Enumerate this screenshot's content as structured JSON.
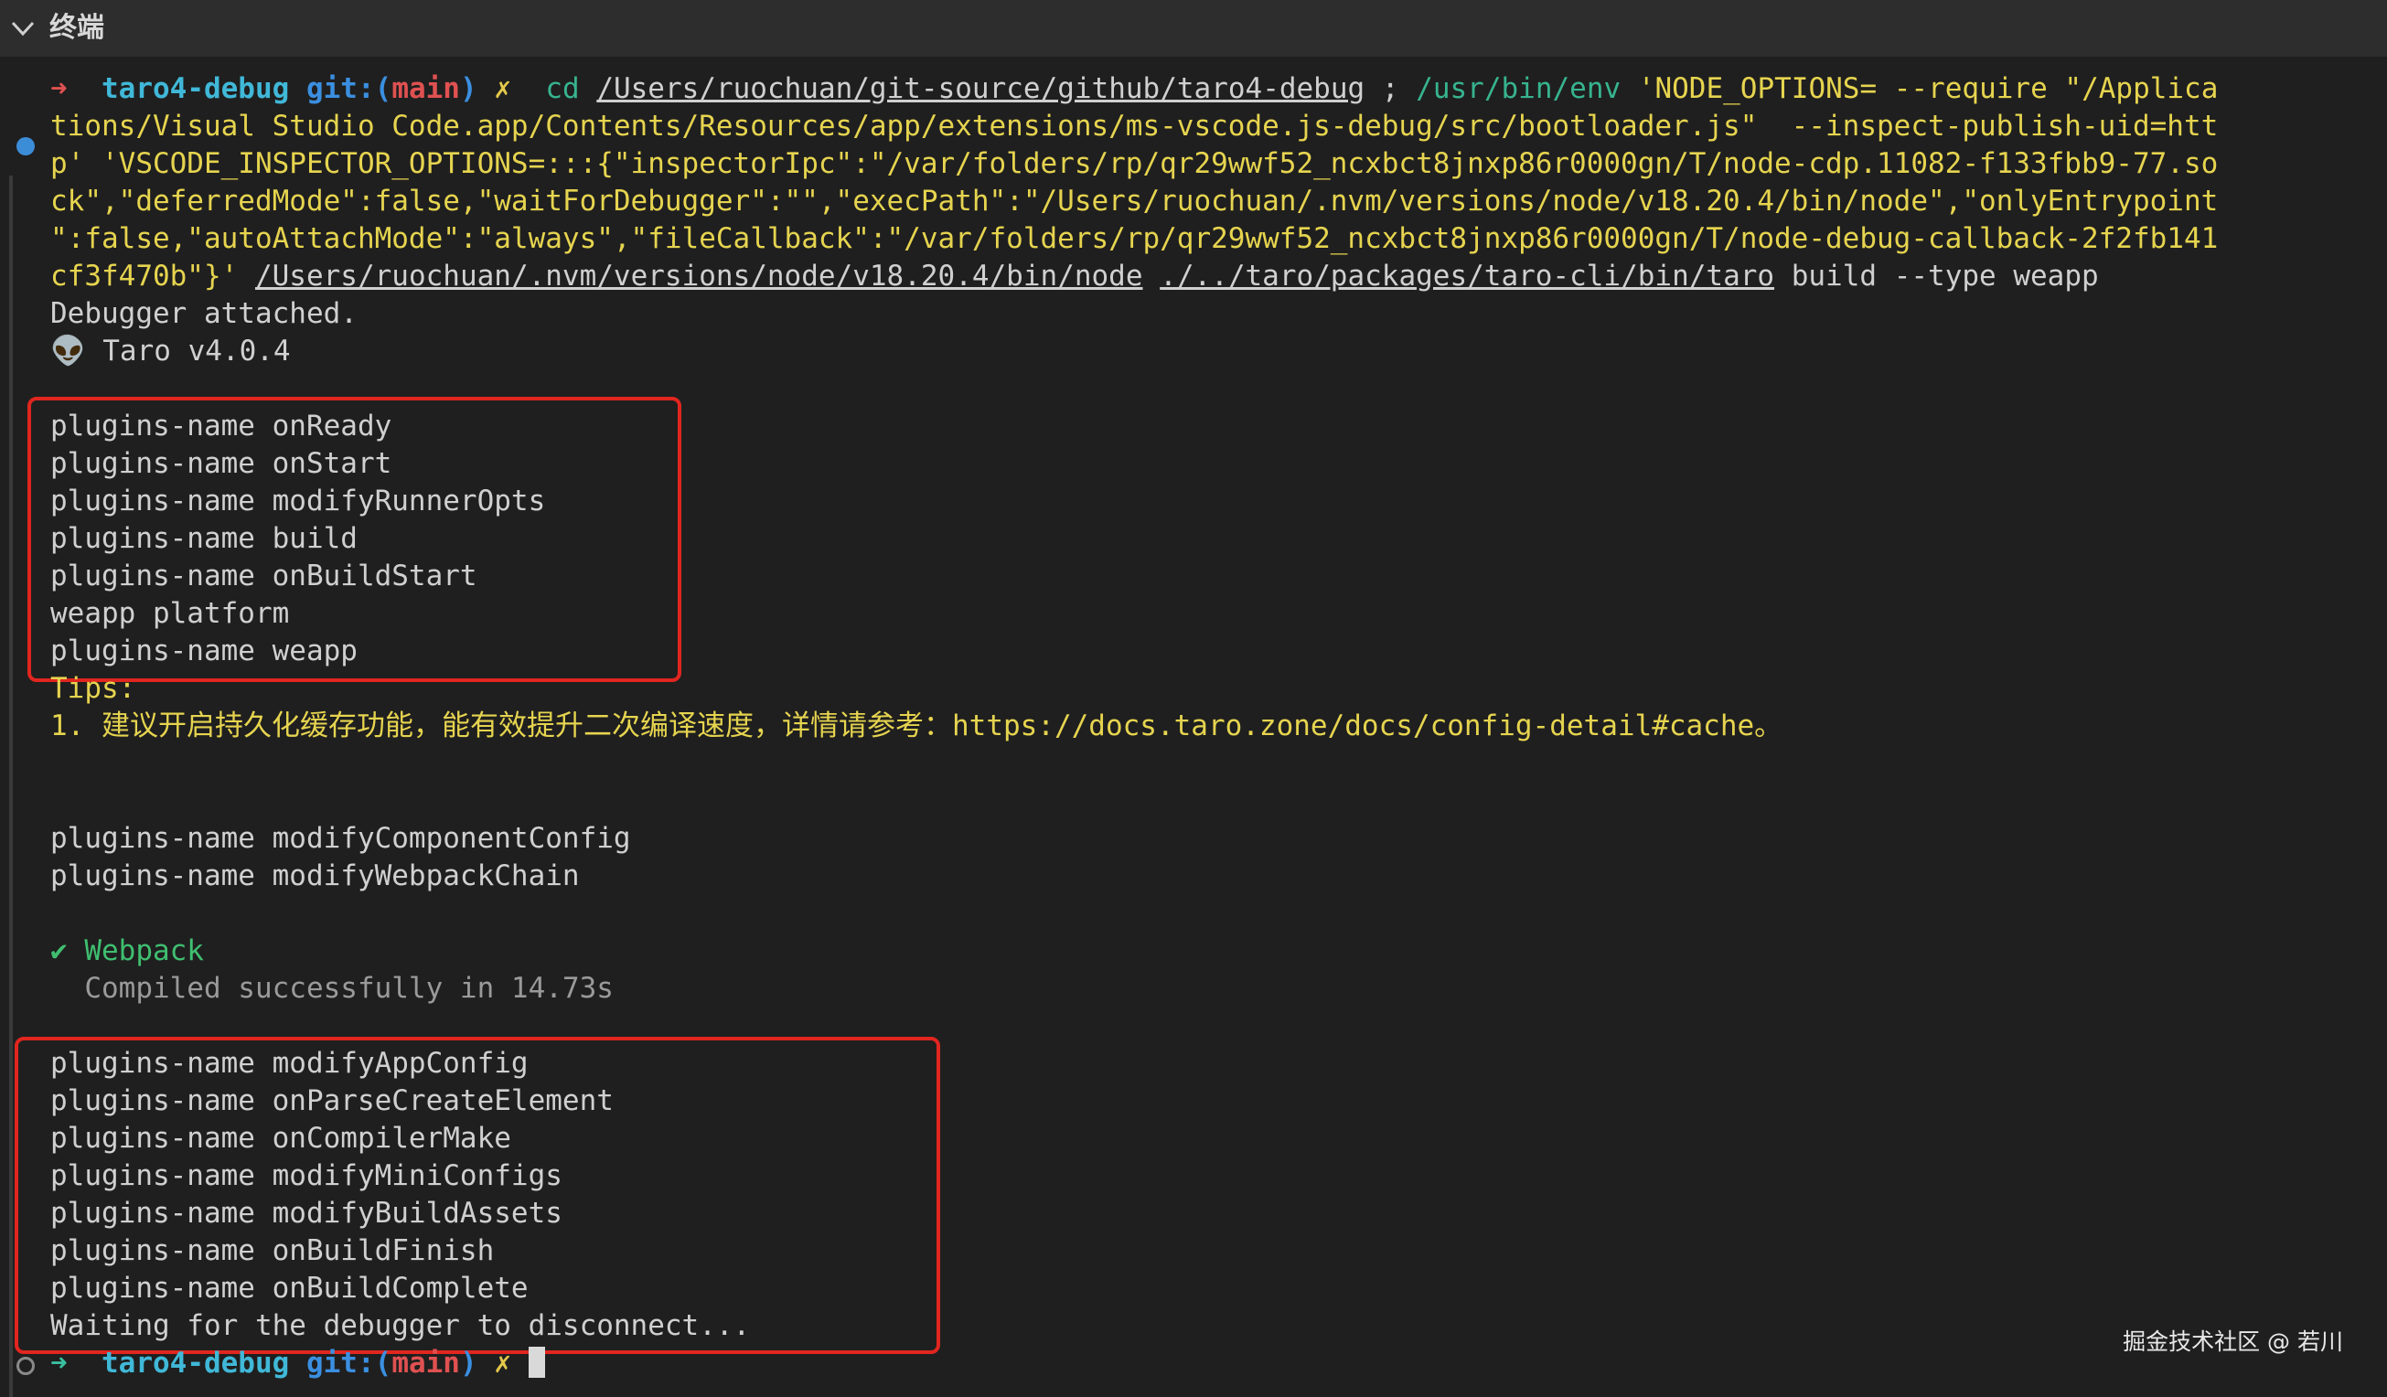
{
  "panel": {
    "title": "终端"
  },
  "prompt": {
    "arrow": "➜",
    "dir": "taro4-debug",
    "git_prefix": "git:(",
    "branch": "main",
    "git_suffix": ")",
    "dirty": "✗"
  },
  "command": {
    "line1": {
      "cd": "cd",
      "path": "/Users/ruochuan/git-source/github/taro4-debug",
      "sep": " ; ",
      "env": "/usr/bin/env",
      "rest": " 'NODE_OPTIONS= --require \"/Applica"
    },
    "line2": "tions/Visual Studio Code.app/Contents/Resources/app/extensions/ms-vscode.js-debug/src/bootloader.js\"  --inspect-publish-uid=htt",
    "line3": "p' 'VSCODE_INSPECTOR_OPTIONS=:::{\"inspectorIpc\":\"/var/folders/rp/qr29wwf52_ncxbct8jnxp86r0000gn/T/node-cdp.11082-f133fbb9-77.so",
    "line4": "ck\",\"deferredMode\":false,\"waitForDebugger\":\"\",\"execPath\":\"/Users/ruochuan/.nvm/versions/node/v18.20.4/bin/node\",\"onlyEntrypoint",
    "line5": "\":false,\"autoAttachMode\":\"always\",\"fileCallback\":\"/var/folders/rp/qr29wwf52_ncxbct8jnxp86r0000gn/T/node-debug-callback-2f2fb141",
    "line6": {
      "pre": "cf3f470b\"}'",
      "node": "/Users/ruochuan/.nvm/versions/node/v18.20.4/bin/node",
      "taro": "./../taro/packages/taro-cli/bin/taro",
      "args": " build --type weapp"
    }
  },
  "output": {
    "debugger_attached": "Debugger attached.",
    "taro_version": "👽 Taro v4.0.4",
    "group1": [
      "plugins-name onReady",
      "plugins-name onStart",
      "plugins-name modifyRunnerOpts",
      "plugins-name build",
      "plugins-name onBuildStart",
      "weapp platform",
      "plugins-name weapp"
    ],
    "tips_label": "Tips:",
    "tips_line": "1. 建议开启持久化缓存功能，能有效提升二次编译速度，详情请参考：https://docs.taro.zone/docs/config-detail#cache。",
    "group2": [
      "plugins-name modifyComponentConfig",
      "plugins-name modifyWebpackChain"
    ],
    "webpack_check": "✔ Webpack",
    "compiled": "  Compiled successfully in 14.73s",
    "group3": [
      "plugins-name modifyAppConfig",
      "plugins-name onParseCreateElement",
      "plugins-name onCompilerMake",
      "plugins-name modifyMiniConfigs",
      "plugins-name modifyBuildAssets",
      "plugins-name onBuildFinish",
      "plugins-name onBuildComplete",
      "Waiting for the debugger to disconnect..."
    ]
  },
  "watermark": "掘金技术社区 @ 若川",
  "colors": {
    "background": "#1f1f1f",
    "header": "#2d2d2d",
    "highlight_box": "#e0261f",
    "prompt_arrow": "#e05151",
    "dir": "#40b8d8",
    "command_yellow": "#e6d44f"
  }
}
